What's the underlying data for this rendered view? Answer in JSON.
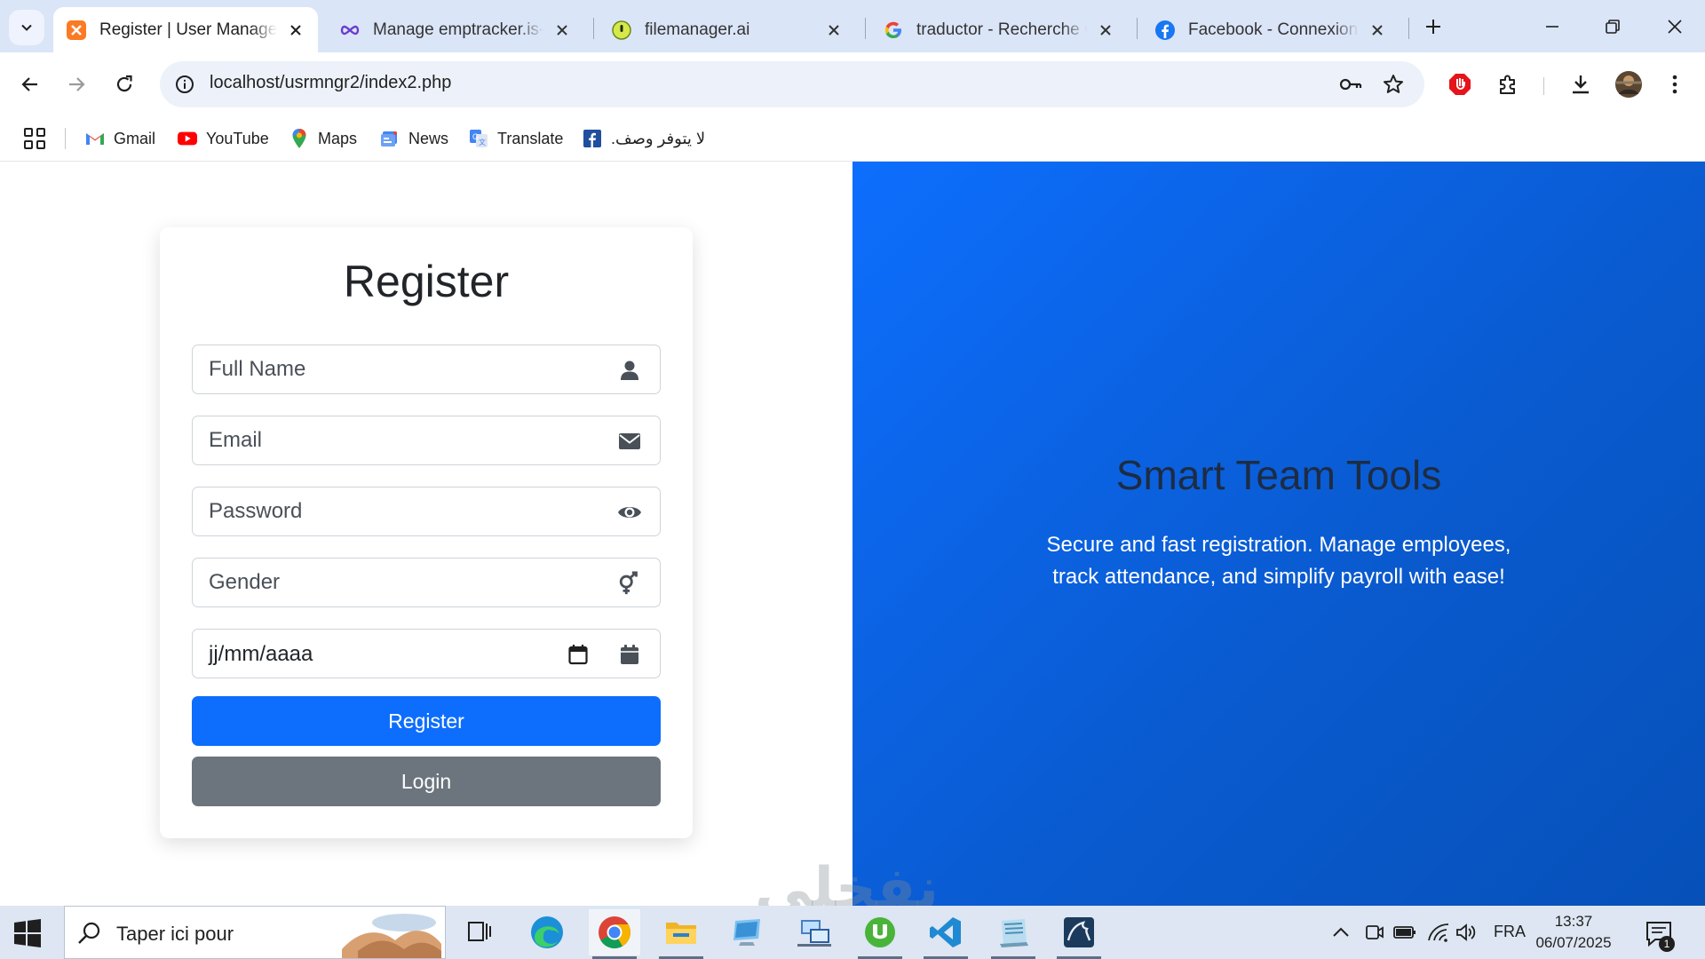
{
  "browser": {
    "tabs": [
      {
        "title": "Register | User Manager",
        "icon": "xampp-icon",
        "active": true
      },
      {
        "title": "Manage emptracker.is-best",
        "icon": "infinity-icon",
        "active": false
      },
      {
        "title": "filemanager.ai",
        "icon": "filemanager-icon",
        "active": false
      },
      {
        "title": "traductor - Recherche Google",
        "icon": "google-icon",
        "active": false
      },
      {
        "title": "Facebook - Connexion ou inscription",
        "icon": "facebook-icon",
        "active": false
      }
    ],
    "address": "localhost/usrmngr2/index2.php",
    "bookmarks": [
      {
        "label": "Gmail",
        "icon": "gmail-icon"
      },
      {
        "label": "YouTube",
        "icon": "youtube-icon"
      },
      {
        "label": "Maps",
        "icon": "maps-icon"
      },
      {
        "label": "News",
        "icon": "news-icon"
      },
      {
        "label": "Translate",
        "icon": "translate-icon"
      },
      {
        "label": "لا يتوفر وصف.",
        "icon": "facebook-icon"
      }
    ]
  },
  "form": {
    "title": "Register",
    "fullname_placeholder": "Full Name",
    "email_placeholder": "Email",
    "password_placeholder": "Password",
    "gender_placeholder": "Gender",
    "date_placeholder": "jj/mm/aaaa",
    "register_label": "Register",
    "login_label": "Login"
  },
  "hero": {
    "title": "Smart Team Tools",
    "text": "Secure and fast registration. Manage employees, track attendance, and simplify payroll with ease!"
  },
  "watermark": "نفخلي",
  "taskbar": {
    "search_placeholder": "Taper ici pour",
    "language": "FRA",
    "time": "13:37",
    "date": "06/07/2025",
    "notification_count": "1"
  },
  "colors": {
    "primary": "#0d6efd",
    "secondary": "#6c757d",
    "hero_bg": "#0a5bd1"
  }
}
